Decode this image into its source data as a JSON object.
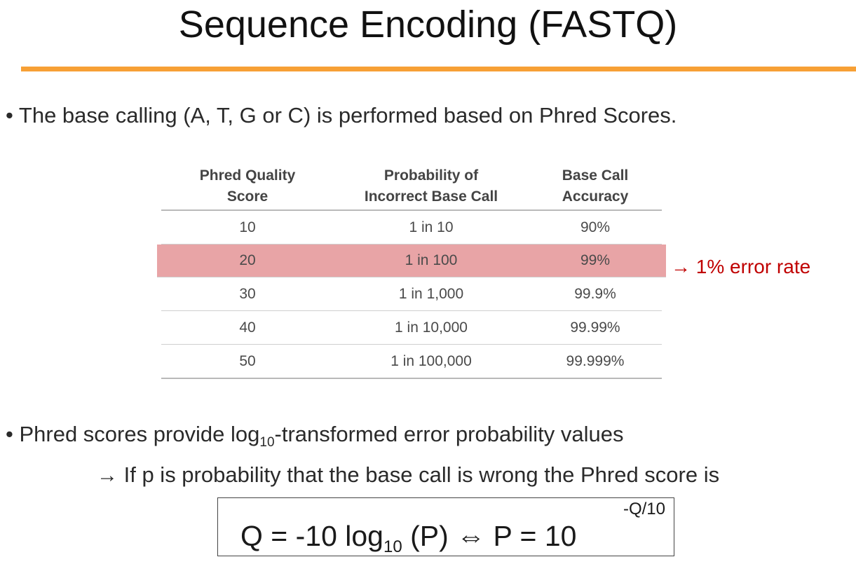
{
  "title": "Sequence Encoding (FASTQ)",
  "bullet1": "• The base calling (A, T, G or C) is performed based on Phred Scores.",
  "table": {
    "headers": [
      [
        "Phred Quality",
        "Score"
      ],
      [
        "Probability of",
        "Incorrect Base Call"
      ],
      [
        "Base Call",
        "Accuracy"
      ]
    ],
    "rows": [
      [
        "10",
        "1 in 10",
        "90%"
      ],
      [
        "20",
        "1 in 100",
        "99%"
      ],
      [
        "30",
        "1 in 1,000",
        "99.9%"
      ],
      [
        "40",
        "1 in 10,000",
        "99.99%"
      ],
      [
        "50",
        "1 in 100,000",
        "99.999%"
      ]
    ]
  },
  "highlight_note": "→ 1% error rate",
  "bullet2": {
    "before": "• Phred scores provide log",
    "sub": "10",
    "after": "-transformed error probability values"
  },
  "line2": {
    "arrow": "→",
    "text": " If p is probability that the base call is wrong the Phred score is"
  },
  "formula": {
    "left": "Q = -10 log",
    "sub": "10",
    "mid": " (P) ⇔ P = 10",
    "sup": "-Q/10"
  },
  "colors": {
    "accent_rule": "#f7a035",
    "highlight_row": "#e8a4a6",
    "note_text": "#c00000"
  }
}
